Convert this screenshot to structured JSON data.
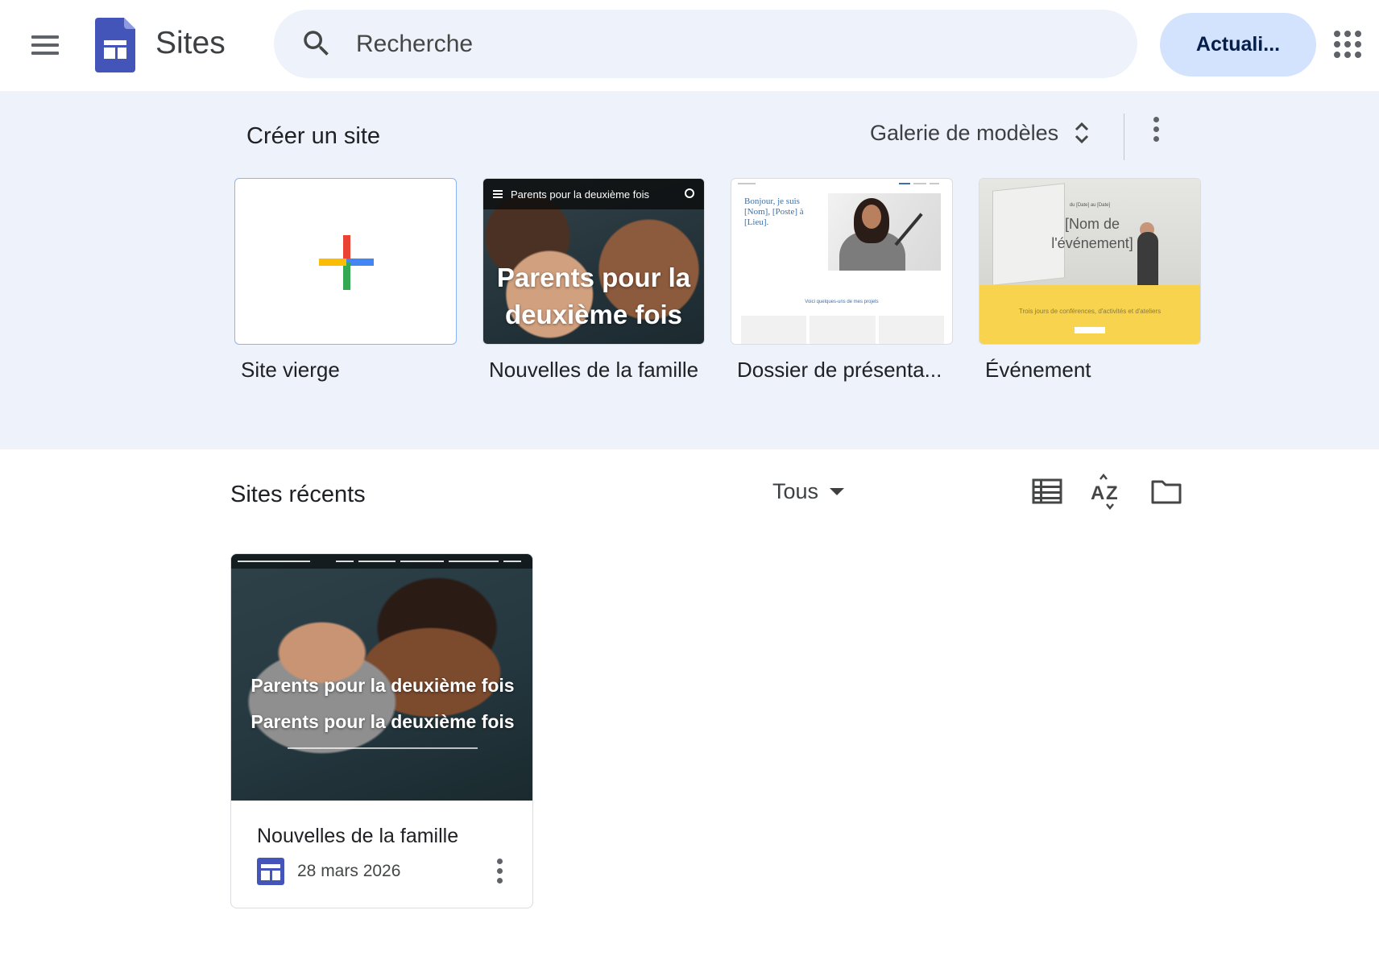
{
  "header": {
    "app_name": "Sites",
    "search_placeholder": "Recherche",
    "update_button": "Actuali..."
  },
  "templates": {
    "title": "Créer un site",
    "gallery_label": "Galerie de modèles",
    "items": [
      {
        "label": "Site vierge"
      },
      {
        "label": "Nouvelles de la famille",
        "thumb_bar": "Parents pour la deuxième fois",
        "thumb_title": "Parents pour la deuxième fois"
      },
      {
        "label": "Dossier de présenta...",
        "thumb_text": "Bonjour, je suis [Nom], [Poste] à [Lieu].",
        "thumb_caption": "Voici quelques-uns de mes projets"
      },
      {
        "label": "Événement",
        "thumb_date": "du [Date] au [Date]",
        "thumb_title": "[Nom de l'événement]",
        "thumb_sub": "Trois jours de conférences, d'activités et d'ateliers"
      }
    ]
  },
  "recent": {
    "title": "Sites récents",
    "filter_label": "Tous",
    "sites": [
      {
        "name": "Nouvelles de la famille",
        "date": "28 mars 2026",
        "thumb_title": "Parents pour la deuxième fois"
      }
    ]
  },
  "colors": {
    "accent": "#d3e3fd",
    "section_bg": "#eef2fa",
    "brand_blue": "#4355b9"
  }
}
